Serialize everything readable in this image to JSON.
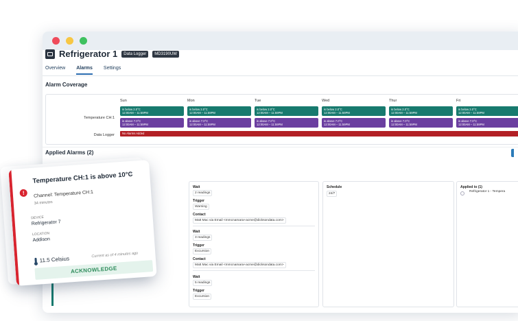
{
  "device": {
    "title": "Refrigerator 1",
    "badges": [
      "Data Logger",
      "MD3190UW"
    ]
  },
  "tabs": [
    {
      "label": "Overview",
      "active": false
    },
    {
      "label": "Alarms",
      "active": true
    },
    {
      "label": "Settings",
      "active": false
    }
  ],
  "coverage": {
    "title": "Alarm Coverage",
    "days": [
      "Sun",
      "Mon",
      "Tue",
      "Wed",
      "Thur",
      "Fri"
    ],
    "rows": [
      {
        "label": "Temperature CH:1",
        "below": {
          "line1": "is below 2.0°C",
          "line2": "12:00AM – 11:59PM"
        },
        "above": {
          "line1": "is above 7.0°C",
          "line2": "12:00AM – 11:59PM"
        }
      },
      {
        "label": "Data Logger",
        "status": "No Alarms Added"
      }
    ]
  },
  "applied": {
    "title": "Applied Alarms (2)",
    "schedule": {
      "header": "Schedule",
      "value": "24/7"
    },
    "applied_to": {
      "header": "Applied to (1)",
      "value": "Refrigerator 1 - Tempera"
    },
    "wait_header": "Wait",
    "trigger_header": "Trigger",
    "contact_header": "Contact",
    "steps": [
      {
        "wait": "2 readings",
        "trigger": "Warning",
        "contact": "Matt Mac via Email <mmcnamara+acme@dicksondata.com>"
      },
      {
        "wait": "3 readings",
        "trigger": "Excursion",
        "contact": "Matt Mac via Email <mmcnamara+acme@dicksondata.com>"
      },
      {
        "wait": "5 readings",
        "trigger": "Excursion"
      }
    ]
  },
  "alert_card": {
    "title": "Temperature CH:1 is above 10°C",
    "channel": "Channel: Temperature CH:1",
    "time_ago": "34 minutes",
    "device_label": "DEVICE",
    "device": "Refrigerator 7",
    "location_label": "LOCATION",
    "location": "Addison",
    "reading": "11.5 Celsius",
    "current_note": "Current as of 4 minutes ago",
    "action": "ACKNOWLEDGE"
  },
  "colors": {
    "teal": "#177a6e",
    "purple": "#6b3fa0",
    "alarm_red": "#b32025",
    "alert_red": "#d8242f",
    "acknowledge_green": "#2e8c5b"
  },
  "icons": [
    "alert-exclamation-icon",
    "chevron-up-icon",
    "thermometer-icon",
    "device-icon"
  ]
}
